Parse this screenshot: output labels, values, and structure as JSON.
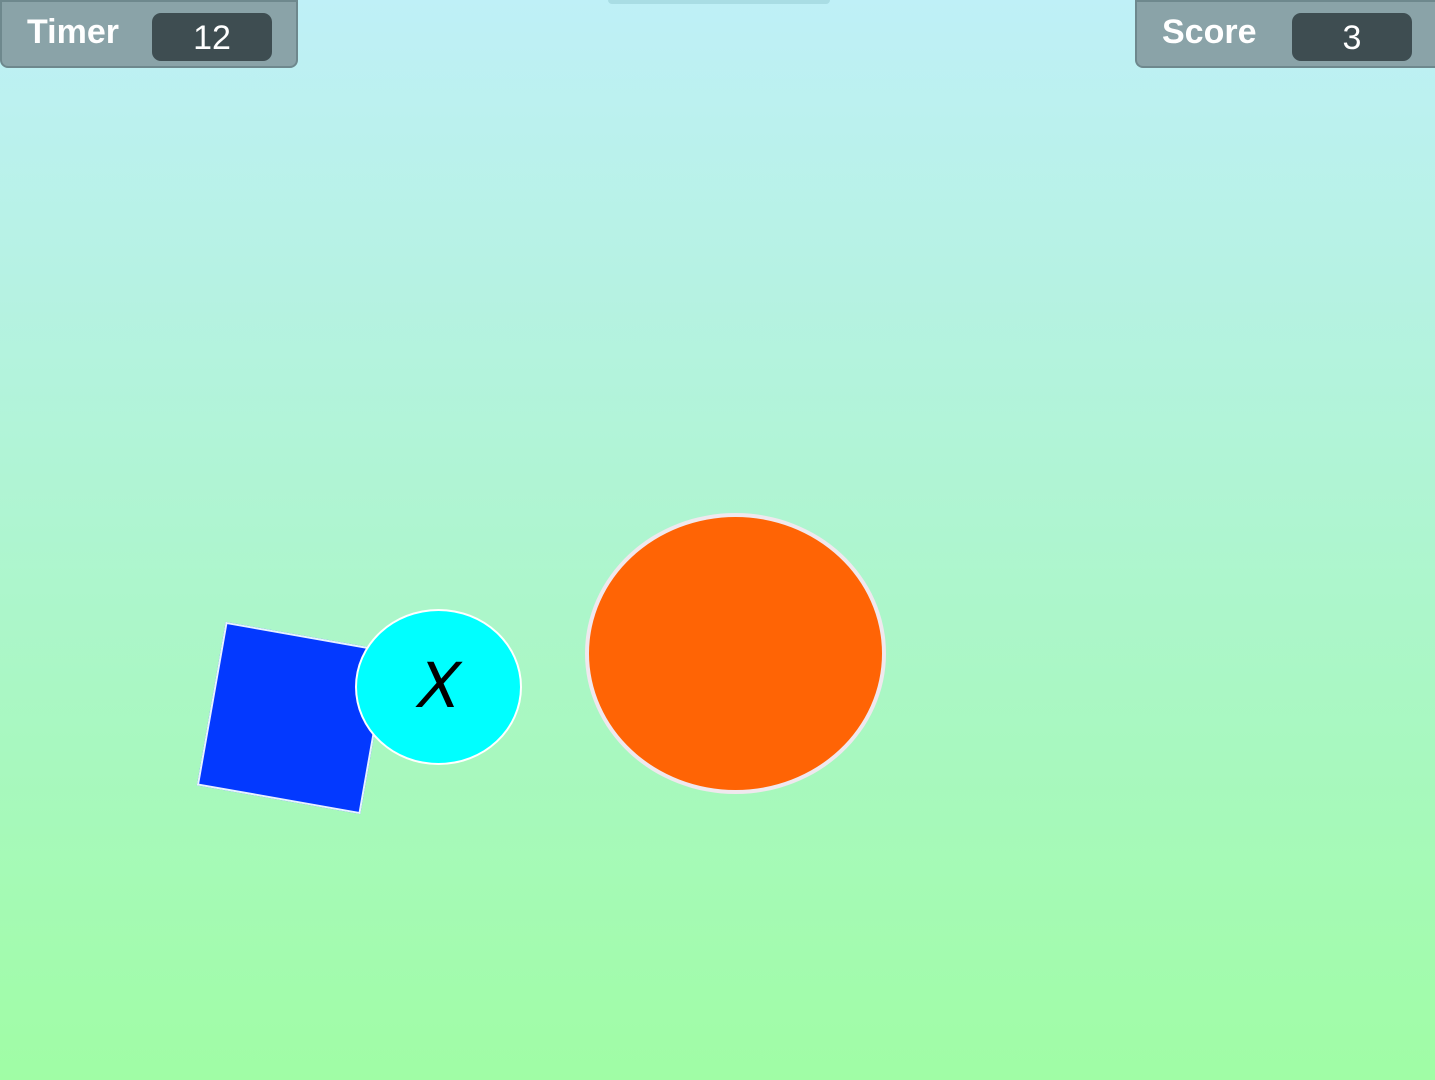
{
  "hud": {
    "timer": {
      "label": "Timer",
      "value": "12"
    },
    "score": {
      "label": "Score",
      "value": "3"
    }
  },
  "game": {
    "shapes": [
      {
        "name": "blue-square",
        "shape": "square",
        "color": "#0339ff"
      },
      {
        "name": "cyan-circle",
        "shape": "circle",
        "color": "#00ffff",
        "mark": "X"
      },
      {
        "name": "orange-circle",
        "shape": "circle",
        "color": "#ff6405"
      }
    ],
    "background": {
      "top_color": "#bff0f7",
      "bottom_color": "#a0fda5"
    }
  }
}
